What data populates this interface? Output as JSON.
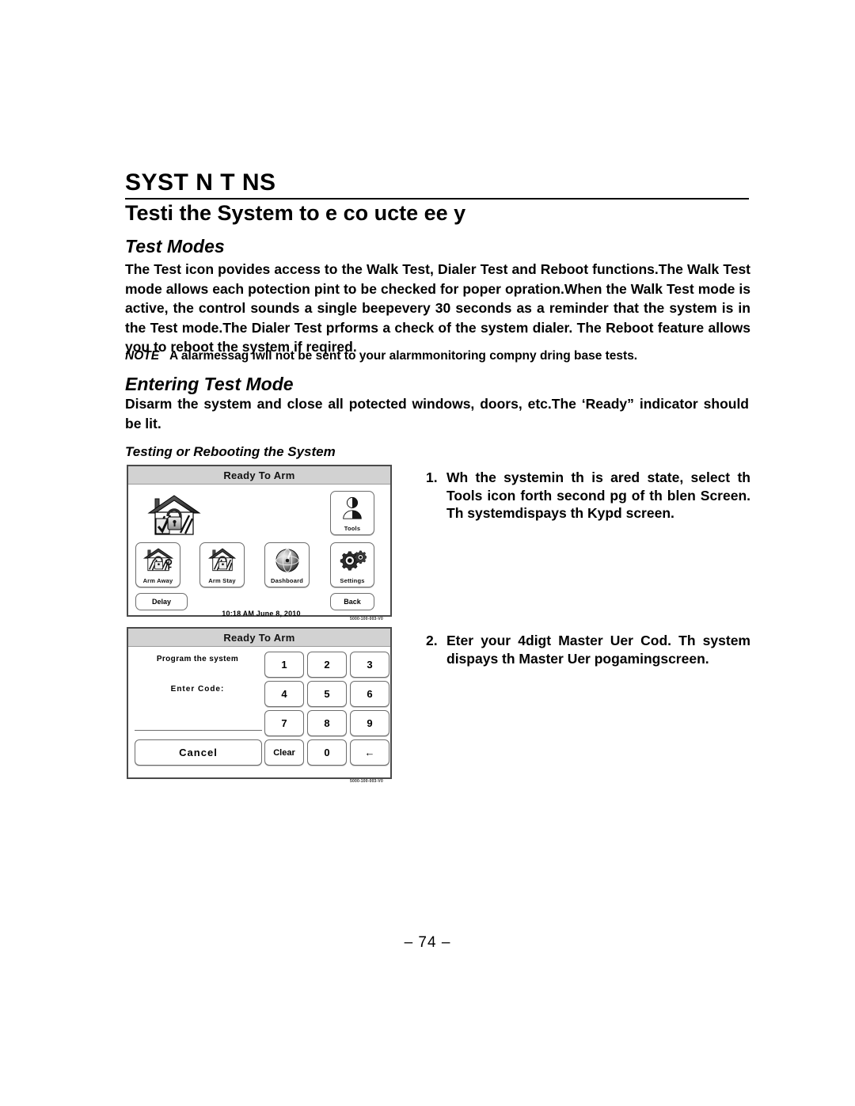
{
  "document": {
    "section_heading": "SYST            N  T    NS",
    "sub_heading": "Testi     the System  to   e co    ucte     ee  y",
    "page_number": "– 74 –"
  },
  "test_modes": {
    "heading": "Test Modes",
    "paragraph": "The Test icon povides access to the Walk Test, Dialer Test and Reboot functions.The Walk Test mode allows each potection pint to be checked for poper opration.When the Walk Test mode is active, the control sounds a single beepevery 30 seconds as a reminder that the system is in the Test mode.The Dialer Test prforms a check of the system dialer. The Reboot feature allows you to reboot the system if reqired.",
    "note_label": "NOTE",
    "note_text": "A alarmessag iwll not be sent to your alarmmonitoring compny dring base tests."
  },
  "entering_test_mode": {
    "heading": "Entering Test Mode",
    "paragraph": "Disarm the system and close all potected windows, doors, etc.The ‘Ready” indicator should be lit."
  },
  "testing_or_rebooting": {
    "heading": "Testing or Rebooting the System",
    "steps": [
      {
        "number": "1.",
        "text": "Wh the  systemin  th  is ared state, select th   Tools    icon forth  second pg of th  blen Screen. Th systemdispays th Kypd screen."
      },
      {
        "number": "2.",
        "text": "Eter your 4digt Master Uer Cod. Th system dispays th  Master  Uer pogamingscreen."
      }
    ]
  },
  "home_panel": {
    "title": "Ready To Arm",
    "status_icon": "house-unlocked-check-icon",
    "buttons": [
      {
        "label": "Tools",
        "icon": "user-person-icon"
      },
      {
        "label": "Arm Away",
        "icon": "house-lock-key-icon"
      },
      {
        "label": "Arm Stay",
        "icon": "house-lock-icon"
      },
      {
        "label": "Dashboard",
        "icon": "gauge-globe-icon"
      },
      {
        "label": "Settings",
        "icon": "gears-icon"
      }
    ],
    "delay_label": "Delay",
    "back_label": "Back",
    "clock": "10:18 AM  June 8,  2010",
    "part_number": "5000-100-003-V0"
  },
  "keypad_panel": {
    "title": "Ready To Arm",
    "prompt": "Program the system",
    "enter_code_label": "Enter Code:",
    "keys": [
      "1",
      "2",
      "3",
      "4",
      "5",
      "6",
      "7",
      "8",
      "9"
    ],
    "cancel_label": "Cancel",
    "clear_label": "Clear",
    "zero_label": "0",
    "backspace_label": "←",
    "part_number": "5000-100-003-V0"
  },
  "colors": {
    "title_bar": "#d2d2d2",
    "panel_border": "#4a4a4a",
    "text": "#000000"
  }
}
